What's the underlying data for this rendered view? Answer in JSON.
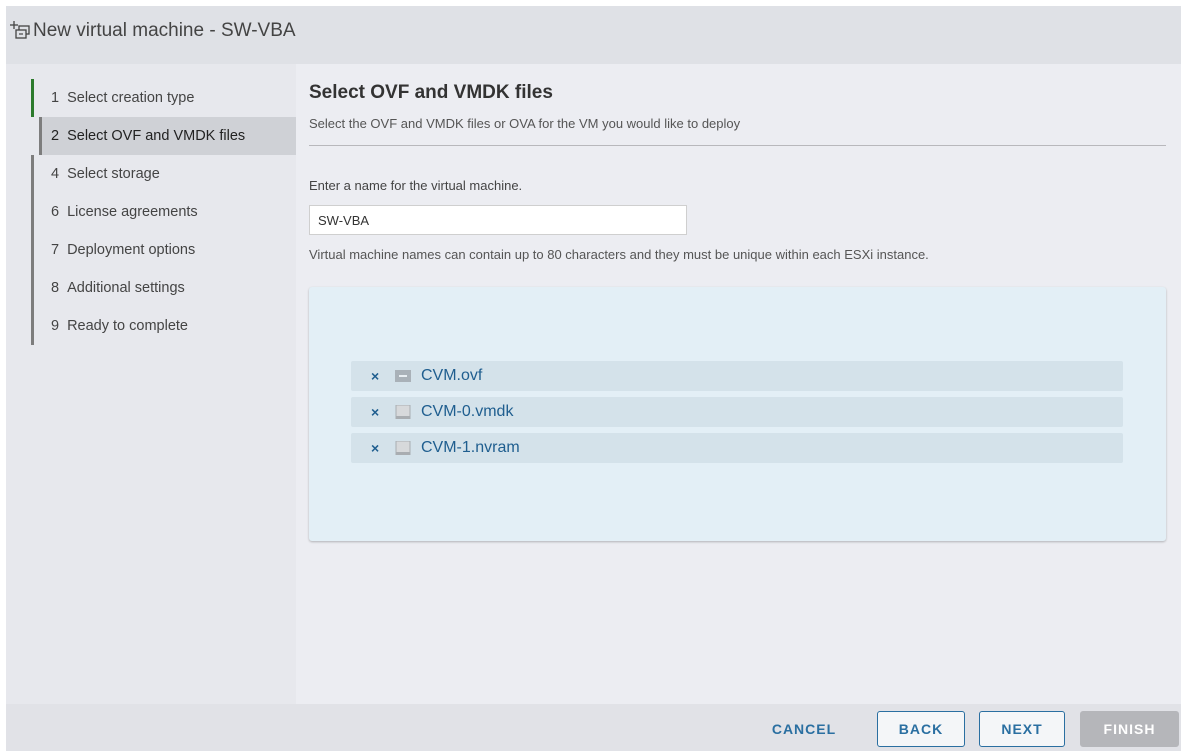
{
  "window": {
    "title": "New virtual machine - SW-VBA"
  },
  "sidebar": {
    "steps": [
      {
        "num": "1",
        "label": "Select creation type",
        "state": "done"
      },
      {
        "num": "2",
        "label": "Select OVF and VMDK files",
        "state": "current"
      },
      {
        "num": "4",
        "label": "Select storage",
        "state": "pending"
      },
      {
        "num": "6",
        "label": "License agreements",
        "state": "pending"
      },
      {
        "num": "7",
        "label": "Deployment options",
        "state": "pending"
      },
      {
        "num": "8",
        "label": "Additional settings",
        "state": "pending"
      },
      {
        "num": "9",
        "label": "Ready to complete",
        "state": "pending"
      }
    ]
  },
  "main": {
    "title": "Select OVF and VMDK files",
    "subtitle": "Select the OVF and VMDK files or OVA for the VM you would like to deploy",
    "name_label": "Enter a name for the virtual machine.",
    "name_value": "SW-VBA",
    "name_hint": "Virtual machine names can contain up to 80 characters and they must be unique within each ESXi instance.",
    "files": [
      {
        "name": "CVM.ovf",
        "icon": "vm-file-icon"
      },
      {
        "name": "CVM-0.vmdk",
        "icon": "disk-file-icon"
      },
      {
        "name": "CVM-1.nvram",
        "icon": "disk-file-icon"
      }
    ]
  },
  "footer": {
    "cancel": "CANCEL",
    "back": "BACK",
    "next": "NEXT",
    "finish": "FINISH"
  },
  "colors": {
    "accent": "#2a6fa1",
    "done_step": "#2c7a2c",
    "dropzone": "#e3eff6"
  }
}
